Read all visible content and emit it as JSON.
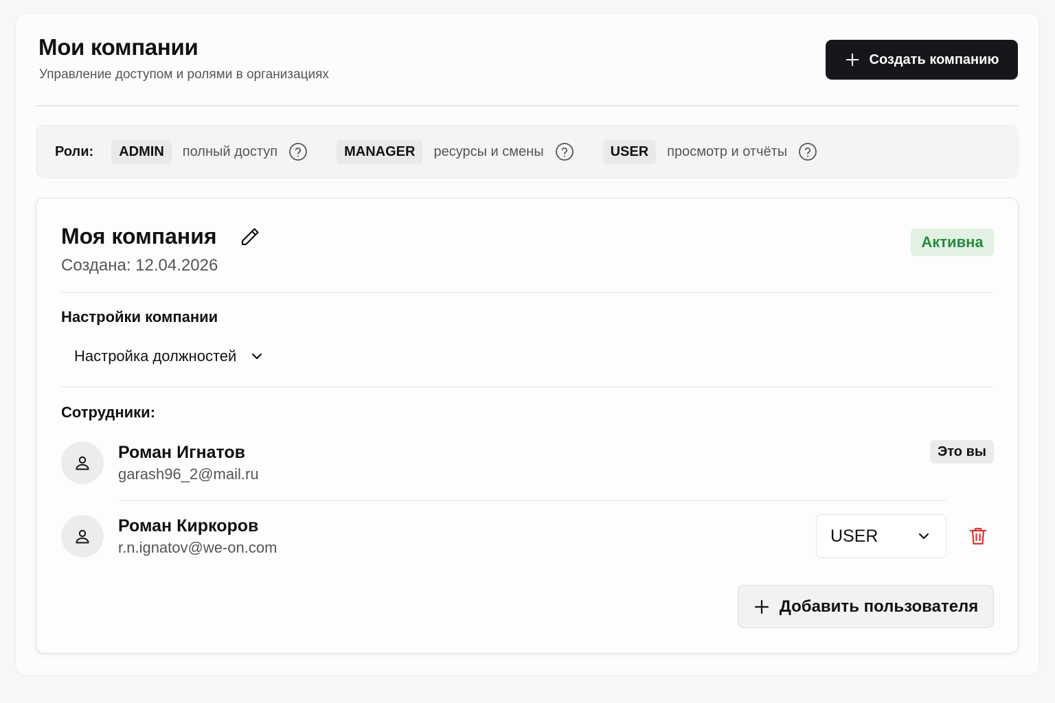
{
  "header": {
    "title": "Мои компании",
    "subtitle": "Управление доступом и ролями в организациях",
    "create_button": "Создать компанию"
  },
  "roles": {
    "label": "Роли:",
    "items": [
      {
        "name": "ADMIN",
        "description": "полный доступ",
        "icon": "help-circle-icon"
      },
      {
        "name": "MANAGER",
        "description": "ресурсы и смены",
        "icon": "help-circle-icon"
      },
      {
        "name": "USER",
        "description": "просмотр и отчёты",
        "icon": "help-circle-icon"
      }
    ]
  },
  "company": {
    "name": "Моя компания",
    "created": "Создана: 12.04.2026",
    "status": "Активна",
    "status_color": "#2b8a3e",
    "settings_title": "Настройки компании",
    "positions_toggle": "Настройка должностей",
    "employees_title": "Сотрудники:",
    "employees": [
      {
        "name": "Роман Игнатов",
        "email": "garash96_2@mail.ru",
        "badge": "Это вы"
      },
      {
        "name": "Роман Киркоров",
        "email": "r.n.ignatov@we-on.com",
        "role": "USER"
      }
    ],
    "add_user_button": "Добавить пользователя"
  },
  "colors": {
    "primary_button": "#15171a",
    "danger": "#e03131",
    "active_badge_bg": "#e1f1e3"
  }
}
